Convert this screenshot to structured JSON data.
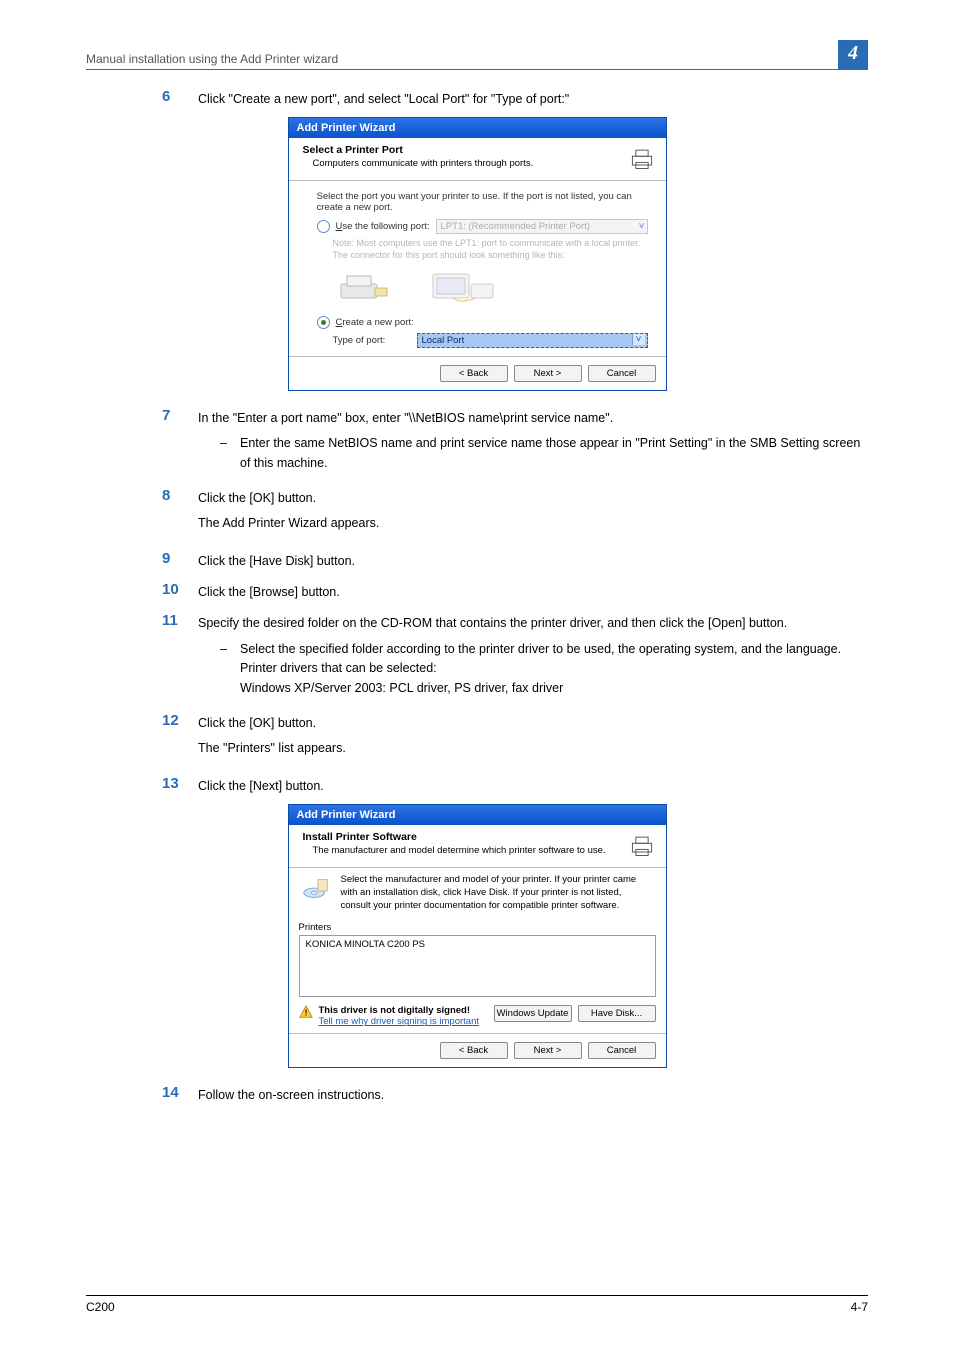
{
  "header": {
    "section_title": "Manual installation using the Add Printer wizard",
    "chapter_number": "4"
  },
  "steps": {
    "s6": {
      "num": "6",
      "text": "Click \"Create a new port\", and select \"Local Port\" for \"Type of port:\""
    },
    "s7": {
      "num": "7",
      "text": "In the \"Enter a port name\" box, enter \"\\\\NetBIOS name\\print service name\".",
      "bullet": "Enter the same NetBIOS name and print service name those appear in \"Print Setting\" in the SMB Setting screen of this machine."
    },
    "s8": {
      "num": "8",
      "text": "Click the [OK] button.",
      "sub": "The Add Printer Wizard appears."
    },
    "s9": {
      "num": "9",
      "text": "Click the [Have Disk] button."
    },
    "s10": {
      "num": "10",
      "text": "Click the [Browse] button."
    },
    "s11": {
      "num": "11",
      "text": "Specify the desired folder on the CD-ROM that contains the printer driver, and then click the [Open] button.",
      "bullet_a": "Select the specified folder according to the printer driver to be used, the operating system, and the language.",
      "bullet_b": "Printer drivers that can be selected:",
      "bullet_c": "Windows XP/Server 2003: PCL driver, PS driver, fax driver"
    },
    "s12": {
      "num": "12",
      "text": "Click the [OK] button.",
      "sub": "The \"Printers\" list appears."
    },
    "s13": {
      "num": "13",
      "text": "Click the [Next] button."
    },
    "s14": {
      "num": "14",
      "text": "Follow the on-screen instructions."
    }
  },
  "wizard1": {
    "title": "Add Printer Wizard",
    "heading": "Select a Printer Port",
    "sub": "Computers communicate with printers through ports.",
    "intro": "Select the port you want your printer to use. If the port is not listed, you can create a new port.",
    "opt_use": "Use the following port:",
    "port_value": "LPT1: (Recommended Printer Port)",
    "note1": "Note: Most computers use the LPT1: port to communicate with a local printer. The connector for this port should look something like this:",
    "opt_create": "Create a new port:",
    "type_label": "Type of port:",
    "type_value": "Local Port",
    "btn_back": "< Back",
    "btn_next": "Next >",
    "btn_cancel": "Cancel"
  },
  "wizard2": {
    "title": "Add Printer Wizard",
    "heading": "Install Printer Software",
    "sub": "The manufacturer and model determine which printer software to use.",
    "intro": "Select the manufacturer and model of your printer. If your printer came with an installation disk, click Have Disk. If your printer is not listed, consult your printer documentation for compatible printer software.",
    "printers_label": "Printers",
    "printer_item": "KONICA MINOLTA C200 PS",
    "warn_bold": "This driver is not digitally signed!",
    "warn_link": "Tell me why driver signing is important",
    "btn_winupdate": "Windows Update",
    "btn_havedisk": "Have Disk...",
    "btn_back": "< Back",
    "btn_next": "Next >",
    "btn_cancel": "Cancel"
  },
  "footer": {
    "left": "C200",
    "right": "4-7"
  }
}
